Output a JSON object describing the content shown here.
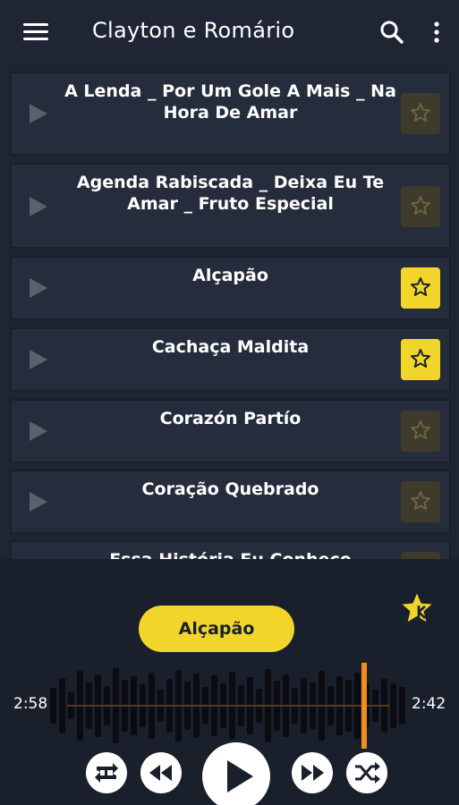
{
  "header": {
    "title": "Clayton e Romário"
  },
  "songs": [
    {
      "title": "A Lenda _ Por Um Gole A Mais _ Na Hora De Amar",
      "favorite": false
    },
    {
      "title": "Agenda Rabiscada _ Deixa Eu Te Amar _ Fruto Especial",
      "favorite": false
    },
    {
      "title": "Alçapão",
      "favorite": true
    },
    {
      "title": "Cachaça Maldita",
      "favorite": true
    },
    {
      "title": "Corazón Partío",
      "favorite": false
    },
    {
      "title": "Coração Quebrado",
      "favorite": false
    },
    {
      "title": "Essa História Eu Conheço",
      "favorite": false
    }
  ],
  "player": {
    "now_playing": "Alçapão",
    "elapsed": "2:58",
    "remaining": "2:42",
    "progress": 0.88
  },
  "colors": {
    "accent": "#f2d52b",
    "background": "#1f2533",
    "card": "#252c3c",
    "progress": "#f28c1e"
  }
}
